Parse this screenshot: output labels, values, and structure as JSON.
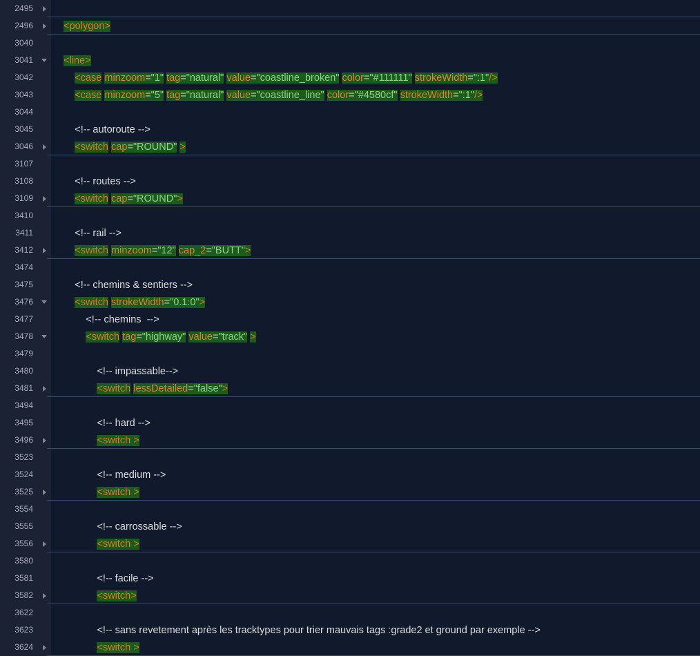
{
  "lines": [
    {
      "n": "2495",
      "fold": "right",
      "foldline": true,
      "indent": 1,
      "tokens": []
    },
    {
      "n": "2496",
      "fold": "right",
      "foldline": true,
      "indent": 1,
      "tokens": [
        [
          "hl tagb",
          "<"
        ],
        [
          "hl tagn",
          "polygon"
        ],
        [
          "hl tagb",
          ">"
        ]
      ]
    },
    {
      "n": "3040",
      "indent": 1,
      "tokens": []
    },
    {
      "n": "3041",
      "fold": "down",
      "indent": 1,
      "tokens": [
        [
          "hl tagb",
          "<"
        ],
        [
          "hl tagn",
          "line"
        ],
        [
          "hl tagb",
          ">"
        ]
      ]
    },
    {
      "n": "3042",
      "indent": 2,
      "tokens": [
        [
          "hl tagb",
          "<"
        ],
        [
          "hl tagn",
          "case"
        ],
        [
          "plain",
          " "
        ],
        [
          "hl attr",
          "minzoom"
        ],
        [
          "hl eq",
          "="
        ],
        [
          "hl val",
          "\"1\""
        ],
        [
          "plain",
          " "
        ],
        [
          "hl attr",
          "tag"
        ],
        [
          "hl eq",
          "="
        ],
        [
          "hl val",
          "\"natural\""
        ],
        [
          "plain",
          " "
        ],
        [
          "hl attr",
          "value"
        ],
        [
          "hl eq",
          "="
        ],
        [
          "hl val",
          "\"coastline_broken\""
        ],
        [
          "plain",
          " "
        ],
        [
          "hl attr",
          "color"
        ],
        [
          "hl eq",
          "="
        ],
        [
          "hl val",
          "\"#111111\""
        ],
        [
          "plain",
          " "
        ],
        [
          "hl attr",
          "strokeWidth"
        ],
        [
          "hl eq",
          "="
        ],
        [
          "hl val",
          "\":1\""
        ],
        [
          "hl tagb",
          "/>"
        ]
      ]
    },
    {
      "n": "3043",
      "indent": 2,
      "tokens": [
        [
          "hl tagb",
          "<"
        ],
        [
          "hl tagn",
          "case"
        ],
        [
          "plain",
          " "
        ],
        [
          "hl attr",
          "minzoom"
        ],
        [
          "hl eq",
          "="
        ],
        [
          "hl val",
          "\"5\""
        ],
        [
          "plain",
          " "
        ],
        [
          "hl attr",
          "tag"
        ],
        [
          "hl eq",
          "="
        ],
        [
          "hl val",
          "\"natural\""
        ],
        [
          "plain",
          " "
        ],
        [
          "hl attr",
          "value"
        ],
        [
          "hl eq",
          "="
        ],
        [
          "hl val",
          "\"coastline_line\""
        ],
        [
          "plain",
          " "
        ],
        [
          "hl attr",
          "color"
        ],
        [
          "hl eq",
          "="
        ],
        [
          "hl val",
          "\"#4580cf\""
        ],
        [
          "plain",
          " "
        ],
        [
          "hl attr",
          "strokeWidth"
        ],
        [
          "hl eq",
          "="
        ],
        [
          "hl val",
          "\":1\""
        ],
        [
          "hl tagb",
          "/>"
        ]
      ]
    },
    {
      "n": "3044",
      "indent": 2,
      "tokens": []
    },
    {
      "n": "3045",
      "indent": 2,
      "tokens": [
        [
          "cmt",
          "<!-- autoroute -->"
        ]
      ]
    },
    {
      "n": "3046",
      "fold": "right",
      "foldline": true,
      "indent": 2,
      "tokens": [
        [
          "hl tagb",
          "<"
        ],
        [
          "hl tagn",
          "switch"
        ],
        [
          "plain",
          " "
        ],
        [
          "hl attr",
          "cap"
        ],
        [
          "hl eq",
          "="
        ],
        [
          "hl val",
          "\"ROUND\""
        ],
        [
          "plain",
          " "
        ],
        [
          "hl tagb",
          ">"
        ]
      ]
    },
    {
      "n": "3107",
      "indent": 2,
      "tokens": []
    },
    {
      "n": "3108",
      "indent": 2,
      "tokens": [
        [
          "cmt",
          "<!-- routes -->"
        ]
      ]
    },
    {
      "n": "3109",
      "fold": "right",
      "foldline": true,
      "indent": 2,
      "tokens": [
        [
          "hl tagb",
          "<"
        ],
        [
          "hl tagn",
          "switch"
        ],
        [
          "plain",
          " "
        ],
        [
          "hl attr",
          "cap"
        ],
        [
          "hl eq",
          "="
        ],
        [
          "hl val",
          "\"ROUND\""
        ],
        [
          "hl tagb",
          ">"
        ]
      ]
    },
    {
      "n": "3410",
      "indent": 2,
      "tokens": []
    },
    {
      "n": "3411",
      "indent": 2,
      "tokens": [
        [
          "cmt",
          "<!-- rail -->"
        ]
      ]
    },
    {
      "n": "3412",
      "fold": "right",
      "foldline": true,
      "indent": 2,
      "tokens": [
        [
          "hl tagb",
          "<"
        ],
        [
          "hl tagn",
          "switch"
        ],
        [
          "plain",
          " "
        ],
        [
          "hl attr",
          "minzoom"
        ],
        [
          "hl eq",
          "="
        ],
        [
          "hl val",
          "\"12\""
        ],
        [
          "plain",
          " "
        ],
        [
          "hl attr",
          "cap_2"
        ],
        [
          "hl eq",
          "="
        ],
        [
          "hl val",
          "\"BUTT\""
        ],
        [
          "hl tagb",
          ">"
        ]
      ]
    },
    {
      "n": "3474",
      "indent": 2,
      "tokens": []
    },
    {
      "n": "3475",
      "indent": 2,
      "tokens": [
        [
          "cmt",
          "<!-- chemins & sentiers -->"
        ]
      ]
    },
    {
      "n": "3476",
      "fold": "down",
      "indent": 2,
      "tokens": [
        [
          "hl tagb",
          "<"
        ],
        [
          "hl tagn",
          "switch"
        ],
        [
          "plain",
          " "
        ],
        [
          "hl attr",
          "strokeWidth"
        ],
        [
          "hl eq",
          "="
        ],
        [
          "hl val",
          "\"0.1:0\""
        ],
        [
          "hl tagb",
          ">"
        ]
      ]
    },
    {
      "n": "3477",
      "indent": 3,
      "tokens": [
        [
          "cmt",
          "<!-- chemins  -->"
        ]
      ]
    },
    {
      "n": "3478",
      "fold": "down",
      "indent": 3,
      "tokens": [
        [
          "hl tagb",
          "<"
        ],
        [
          "hl tagn",
          "switch"
        ],
        [
          "plain",
          " "
        ],
        [
          "hl attr",
          "tag"
        ],
        [
          "hl eq",
          "="
        ],
        [
          "hl val",
          "\"highway\""
        ],
        [
          "plain",
          " "
        ],
        [
          "hl attr",
          "value"
        ],
        [
          "hl eq",
          "="
        ],
        [
          "hl val",
          "\"track\""
        ],
        [
          "plain",
          " "
        ],
        [
          "hl tagb",
          ">"
        ]
      ]
    },
    {
      "n": "3479",
      "indent": 4,
      "tokens": []
    },
    {
      "n": "3480",
      "indent": 4,
      "tokens": [
        [
          "cmt",
          "<!-- impassable-->"
        ]
      ]
    },
    {
      "n": "3481",
      "fold": "right",
      "foldline": true,
      "indent": 4,
      "tokens": [
        [
          "hl tagb",
          "<"
        ],
        [
          "hl tagn",
          "switch"
        ],
        [
          "plain",
          " "
        ],
        [
          "hl attr",
          "lessDetailed"
        ],
        [
          "hl eq",
          "="
        ],
        [
          "hl val",
          "\"false\""
        ],
        [
          "hl tagb",
          ">"
        ]
      ]
    },
    {
      "n": "3494",
      "indent": 4,
      "tokens": []
    },
    {
      "n": "3495",
      "indent": 4,
      "tokens": [
        [
          "cmt",
          "<!-- hard -->"
        ]
      ]
    },
    {
      "n": "3496",
      "fold": "right",
      "foldline": true,
      "indent": 4,
      "tokens": [
        [
          "hl tagb",
          "<"
        ],
        [
          "hl tagn",
          "switch "
        ],
        [
          "hl tagb",
          ">"
        ]
      ]
    },
    {
      "n": "3523",
      "indent": 4,
      "tokens": []
    },
    {
      "n": "3524",
      "indent": 4,
      "tokens": [
        [
          "cmt",
          "<!-- medium -->"
        ]
      ]
    },
    {
      "n": "3525",
      "fold": "right",
      "foldline": true,
      "indent": 4,
      "tokens": [
        [
          "hl tagb",
          "<"
        ],
        [
          "hl tagn",
          "switch "
        ],
        [
          "hl tagb",
          ">"
        ]
      ]
    },
    {
      "n": "3554",
      "indent": 4,
      "tokens": []
    },
    {
      "n": "3555",
      "indent": 4,
      "tokens": [
        [
          "cmt",
          "<!-- carrossable -->"
        ]
      ]
    },
    {
      "n": "3556",
      "fold": "right",
      "foldline": true,
      "indent": 4,
      "tokens": [
        [
          "hl tagb",
          "<"
        ],
        [
          "hl tagn",
          "switch "
        ],
        [
          "hl tagb",
          ">"
        ]
      ]
    },
    {
      "n": "3580",
      "indent": 4,
      "tokens": []
    },
    {
      "n": "3581",
      "indent": 4,
      "tokens": [
        [
          "cmt",
          "<!-- facile -->"
        ]
      ]
    },
    {
      "n": "3582",
      "fold": "right",
      "foldline": true,
      "indent": 4,
      "tokens": [
        [
          "hl tagb",
          "<"
        ],
        [
          "hl tagn",
          "switch"
        ],
        [
          "hl tagb",
          ">"
        ]
      ]
    },
    {
      "n": "3622",
      "indent": 4,
      "tokens": []
    },
    {
      "n": "3623",
      "indent": 4,
      "tokens": [
        [
          "cmt",
          "<!-- sans revetement après les tracktypes pour trier mauvais tags :grade2 et ground par exemple -->"
        ]
      ]
    },
    {
      "n": "3624",
      "fold": "right",
      "foldline": true,
      "indent": 4,
      "tokens": [
        [
          "hl tagb",
          "<"
        ],
        [
          "hl tagn",
          "switch "
        ],
        [
          "hl tagb",
          ">"
        ]
      ]
    }
  ],
  "indentUnit": "    "
}
